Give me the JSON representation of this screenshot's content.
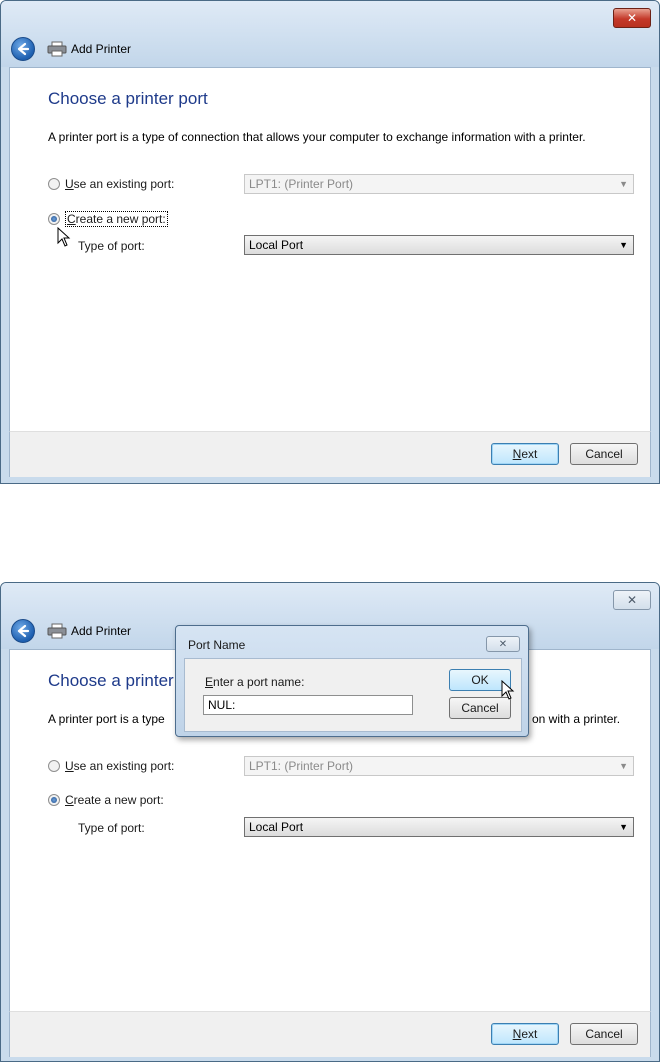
{
  "window": {
    "title": "Add Printer",
    "close_glyph": "✕"
  },
  "page": {
    "heading": "Choose a printer port",
    "description": "A printer port is a type of connection that allows your computer to exchange information with a printer."
  },
  "options": {
    "existing_port": {
      "label": "Use an existing port:",
      "accel": "U",
      "selected": false,
      "value": "LPT1: (Printer Port)"
    },
    "new_port": {
      "label": "Create a new port:",
      "accel": "C",
      "selected": true
    },
    "type_of_port": {
      "label": "Type of port:",
      "value": "Local Port"
    }
  },
  "footer": {
    "next_label": "Next",
    "next_accel": "N",
    "cancel_label": "Cancel"
  },
  "dialog": {
    "title": "Port Name",
    "close_glyph": "✕",
    "prompt": "Enter a port name:",
    "prompt_accel": "E",
    "input_value": "NUL:",
    "ok_label": "OK",
    "cancel_label": "Cancel"
  },
  "overlapped_text": {
    "heading_partial": "Choose a printer",
    "description_start": "A printer port is a type",
    "description_end": "on with a printer."
  },
  "colors": {
    "heading": "#1e3a8a",
    "frame": "#c9dbec",
    "close_red": "#c4392a",
    "default_button": "#bee6fd"
  },
  "icons": {
    "back": "back-arrow-icon",
    "printer": "printer-icon",
    "close": "close-icon",
    "cursor": "mouse-pointer-icon"
  }
}
